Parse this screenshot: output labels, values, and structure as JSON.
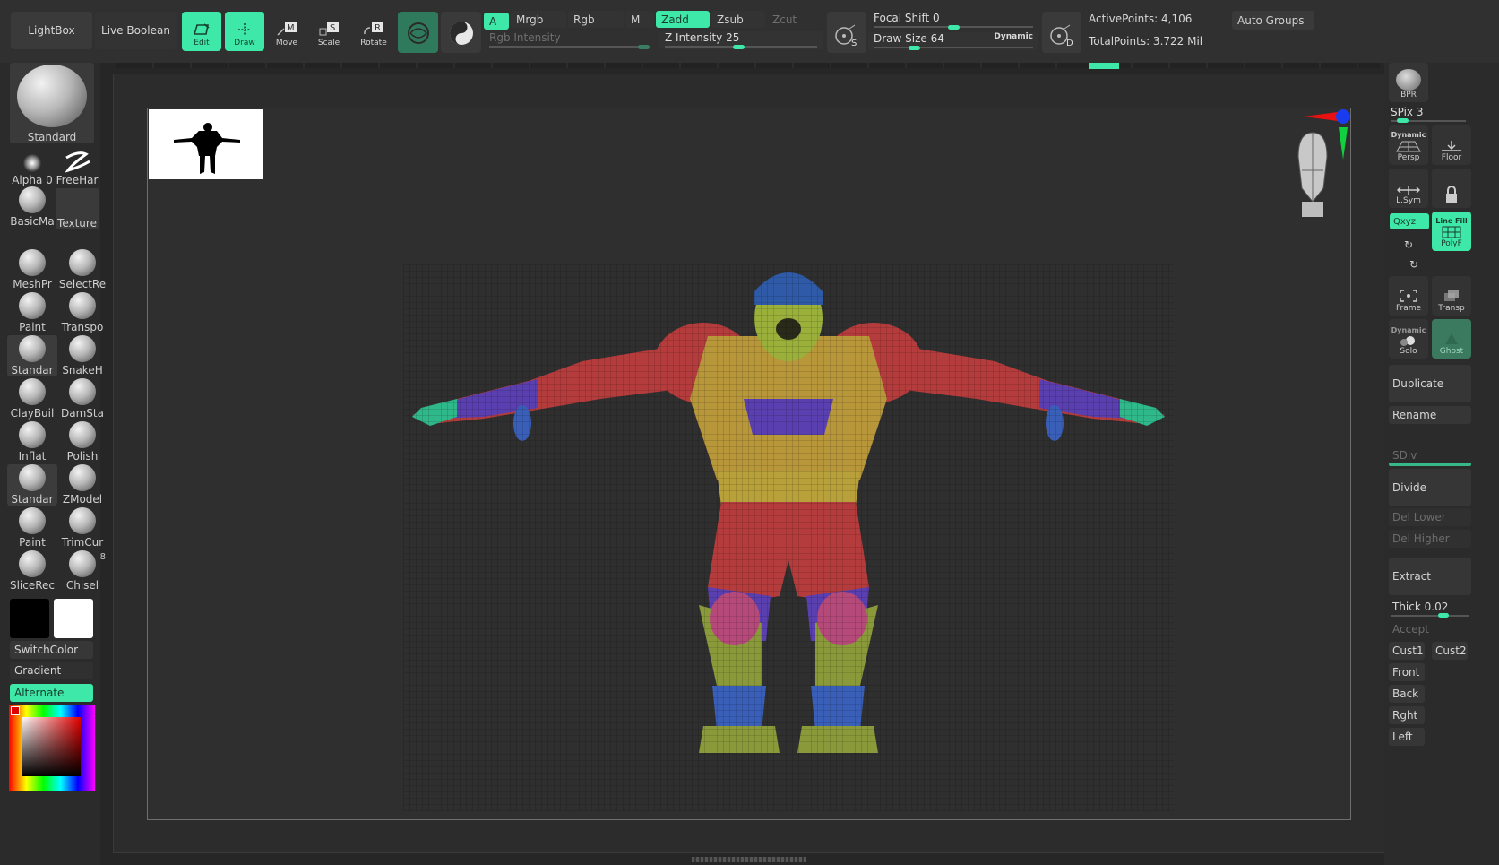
{
  "topbar": {
    "lightbox": "LightBox",
    "live_boolean": "Live Boolean",
    "tools": {
      "edit": "Edit",
      "draw": "Draw",
      "move": "Move",
      "scale": "Scale",
      "rotate": "Rotate"
    },
    "chips": {
      "a": "A",
      "mrgb": "Mrgb",
      "rgb": "Rgb",
      "m": "M",
      "zadd": "Zadd",
      "zsub": "Zsub",
      "zcut": "Zcut"
    },
    "rgb_intensity_label": "Rgb Intensity",
    "z_intensity_label": "Z Intensity",
    "z_intensity_value": "25",
    "focal_shift_label": "Focal Shift",
    "focal_shift_value": "0",
    "draw_size_label": "Draw Size",
    "draw_size_value": "64",
    "dynamic_label": "Dynamic",
    "active_points": "ActivePoints: 4,106",
    "total_points": "TotalPoints: 3.722 Mil",
    "auto_groups": "Auto Groups",
    "s_label": "S",
    "d_label": "D"
  },
  "left": {
    "main_brush": "Standard",
    "alpha": "Alpha 0",
    "freehand": "FreeHar",
    "basic_material": "BasicMa",
    "texture": "Texture",
    "brushes": [
      {
        "label": "MeshPr"
      },
      {
        "label": "SelectRe"
      },
      {
        "label": "Paint"
      },
      {
        "label": "Transpo"
      },
      {
        "label": "Standar"
      },
      {
        "label": "SnakeH"
      },
      {
        "label": "ClayBuil"
      },
      {
        "label": "DamSta"
      },
      {
        "label": "Inflat"
      },
      {
        "label": "Polish"
      },
      {
        "label": "Standar"
      },
      {
        "label": "ZModel"
      },
      {
        "label": "Paint"
      },
      {
        "label": "TrimCur"
      },
      {
        "label": "SliceRec"
      },
      {
        "label": "Chisel"
      }
    ],
    "chisel_badge": "8",
    "switch_color": "SwitchColor",
    "gradient": "Gradient",
    "alternate": "Alternate"
  },
  "right": {
    "bpr": "BPR",
    "spix": "SPix 3",
    "dynamic": "Dynamic",
    "persp": "Persp",
    "floor": "Floor",
    "lsym": "L.Sym",
    "xyz": "Qxyz",
    "line_fill": "Line Fill",
    "polyf": "PolyF",
    "frame": "Frame",
    "transp": "Transp",
    "solo": "Solo",
    "ghost": "Ghost",
    "duplicate": "Duplicate",
    "rename": "Rename",
    "sdiv": "SDiv",
    "divide": "Divide",
    "del_lower": "Del Lower",
    "del_higher": "Del Higher",
    "extract": "Extract",
    "thick": "Thick 0.02",
    "accept": "Accept",
    "cust1": "Cust1",
    "cust2": "Cust2",
    "front": "Front",
    "back": "Back",
    "rght": "Rght",
    "left": "Left"
  },
  "colors": {
    "accent": "#3ee8a8",
    "panel": "#2b2b2b",
    "canvas": "#2c2c2c"
  }
}
